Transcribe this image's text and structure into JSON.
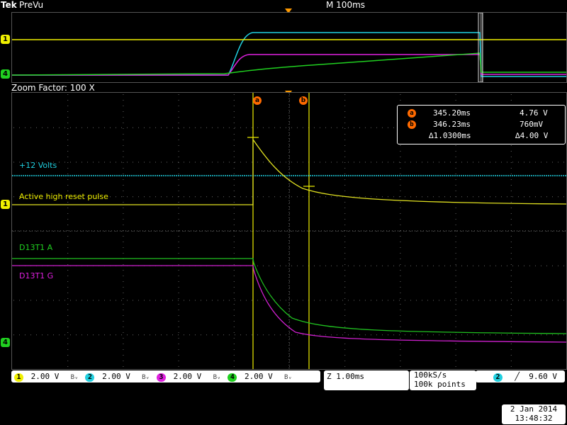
{
  "header": {
    "brand": "Tek",
    "mode": "PreVu",
    "timebase": "M 100ms"
  },
  "zoom": {
    "label": "Zoom Factor: 100 X"
  },
  "channels": {
    "ch1": {
      "num": "1",
      "color": "#f0f000"
    },
    "ch2": {
      "num": "2",
      "color": "#20d0e0"
    },
    "ch3": {
      "num": "3",
      "color": "#e020e0"
    },
    "ch4": {
      "num": "4",
      "color": "#20d020"
    }
  },
  "trace_labels": {
    "plus12": "+12 Volts",
    "reset": "Active high reset pulse",
    "d13a": "D13T1 A",
    "d13g": "D13T1 G"
  },
  "cursors": {
    "a_flag": "a",
    "b_flag": "b",
    "a_time": "345.20ms",
    "a_volt": "4.76 V",
    "b_time": "346.23ms",
    "b_volt": "760mV",
    "delta_time": "∆1.0300ms",
    "delta_volt": "∆4.00 V"
  },
  "bottom": {
    "ch1_scale": "2.00 V",
    "ch2_scale": "2.00 V",
    "ch3_scale": "2.00 V",
    "ch4_scale": "2.00 V",
    "bw_symbol": "Bᵥ",
    "zoom_time": "Z 1.00ms",
    "sample_rate": "100kS/s",
    "record_length": "100k points",
    "trigger_channel": "2",
    "trigger_slope": "∠",
    "trigger_level": "9.60 V",
    "date": "2 Jan  2014",
    "time": "13:48:32"
  }
}
